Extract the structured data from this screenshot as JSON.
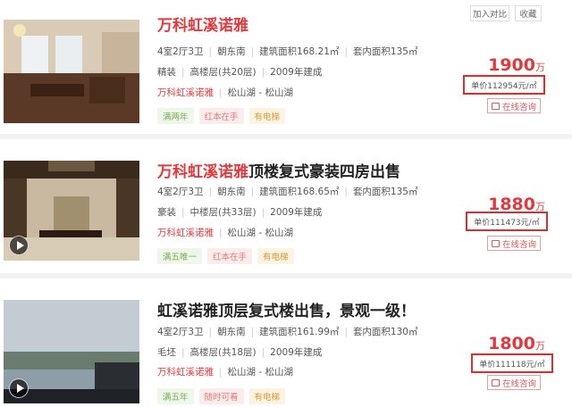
{
  "top_actions": {
    "compare_label": "加入对比",
    "favorite_label": "收藏"
  },
  "listings": [
    {
      "title_highlight": "万科虹溪诺雅",
      "title_rest": "",
      "layout": "4室2厅3卫",
      "orientation": "朝东南",
      "built_area": "建筑面积168.21㎡",
      "inner_area": "套内面积135㎡",
      "decoration": "精装",
      "floor": "高楼层(共20层)",
      "year": "2009年建成",
      "community": "万科虹溪诺雅",
      "location": "松山湖 - 松山湖",
      "tags": [
        "满两年",
        "红本在手",
        "有电梯"
      ],
      "price": "1900",
      "price_unit": "万",
      "unit_price": "单价112954元/㎡",
      "consult_label": "在线咨询",
      "has_video": false
    },
    {
      "title_highlight": "万科虹溪诺雅",
      "title_rest": "顶楼复式豪装四房出售",
      "layout": "4室2厅3卫",
      "orientation": "朝东南",
      "built_area": "建筑面积168.65㎡",
      "inner_area": "套内面积135㎡",
      "decoration": "豪装",
      "floor": "中楼层(共33层)",
      "year": "2009年建成",
      "community": "万科虹溪诺雅",
      "location": "松山湖 - 松山湖",
      "tags": [
        "满五唯一",
        "红本在手",
        "有电梯"
      ],
      "price": "1880",
      "price_unit": "万",
      "unit_price": "单价111473元/㎡",
      "consult_label": "在线咨询",
      "has_video": true
    },
    {
      "title_highlight": "",
      "title_rest": "虹溪诺雅顶层复式楼出售，景观一级！",
      "layout": "4室2厅3卫",
      "orientation": "朝东南",
      "built_area": "建筑面积161.99㎡",
      "inner_area": "套内面积130㎡",
      "decoration": "毛坯",
      "floor": "高楼层(共18层)",
      "year": "2009年建成",
      "community": "万科虹溪诺雅",
      "location": "松山湖 - 松山湖",
      "tags": [
        "满五年",
        "随时可看",
        "有电梯"
      ],
      "price": "1800",
      "price_unit": "万",
      "unit_price": "单价111118元/㎡",
      "consult_label": "在线咨询",
      "has_video": true
    }
  ]
}
